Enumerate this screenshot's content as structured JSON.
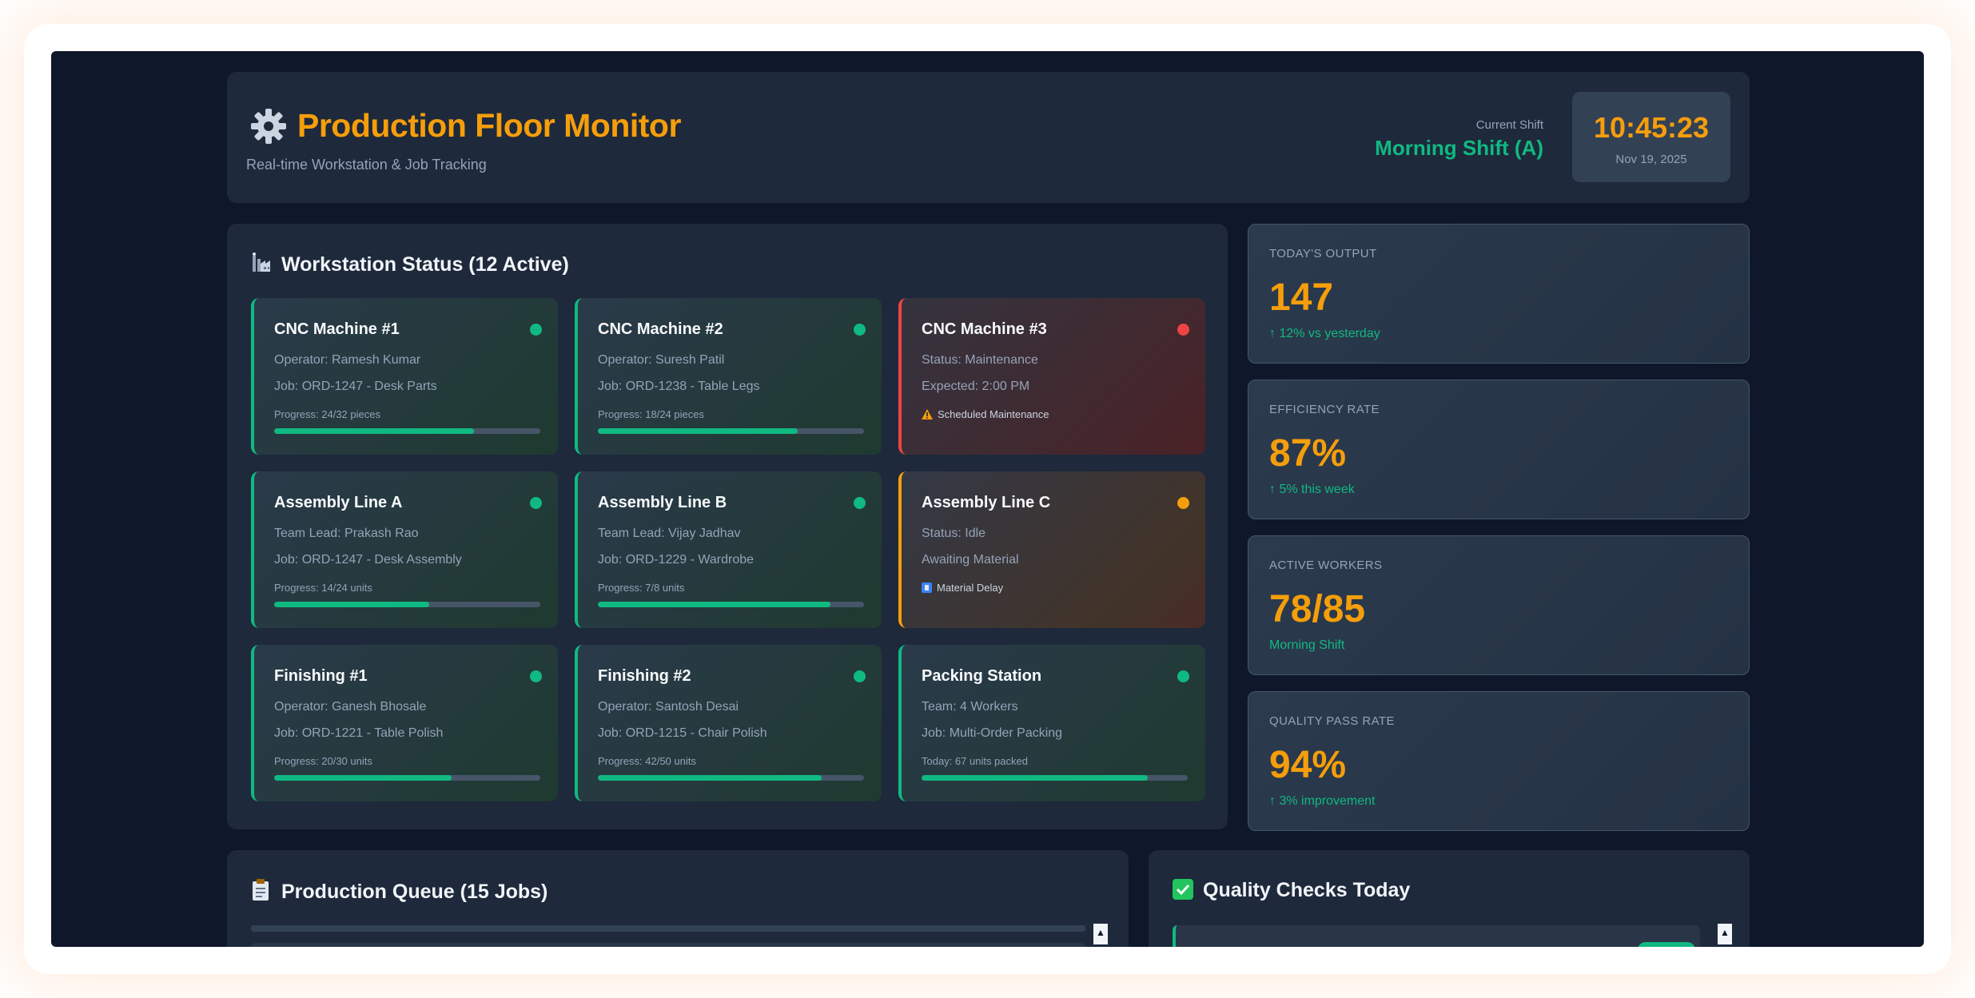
{
  "header": {
    "title": "Production Floor Monitor",
    "subtitle": "Real-time Workstation & Job Tracking",
    "icon": "gear-icon",
    "shift_label": "Current Shift",
    "shift_name": "Morning Shift (A)",
    "clock_time": "10:45:23",
    "clock_date": "Nov 19, 2025"
  },
  "workstations": {
    "title": "Workstation Status (12 Active)",
    "icon": "factory-icon",
    "cards": [
      {
        "name": "CNC Machine #1",
        "line1": "Operator: Ramesh Kumar",
        "line2": "Job: ORD-1247 - Desk Parts",
        "progress_label": "Progress: 24/32 pieces",
        "progress": 0.75,
        "status": "active"
      },
      {
        "name": "CNC Machine #2",
        "line1": "Operator: Suresh Patil",
        "line2": "Job: ORD-1238 - Table Legs",
        "progress_label": "Progress: 18/24 pieces",
        "progress": 0.75,
        "status": "active"
      },
      {
        "name": "CNC Machine #3",
        "line1": "Status: Maintenance",
        "line2": "Expected: 2:00 PM",
        "note": "Scheduled Maintenance",
        "note_icon": "warning-icon",
        "status": "down"
      },
      {
        "name": "Assembly Line A",
        "line1": "Team Lead: Prakash Rao",
        "line2": "Job: ORD-1247 - Desk Assembly",
        "progress_label": "Progress: 14/24 units",
        "progress": 0.583,
        "status": "active"
      },
      {
        "name": "Assembly Line B",
        "line1": "Team Lead: Vijay Jadhav",
        "line2": "Job: ORD-1229 - Wardrobe",
        "progress_label": "Progress: 7/8 units",
        "progress": 0.875,
        "status": "active"
      },
      {
        "name": "Assembly Line C",
        "line1": "Status: Idle",
        "line2": "Awaiting Material",
        "note": "Material Delay",
        "note_icon": "box-icon",
        "status": "idle"
      },
      {
        "name": "Finishing #1",
        "line1": "Operator: Ganesh Bhosale",
        "line2": "Job: ORD-1221 - Table Polish",
        "progress_label": "Progress: 20/30 units",
        "progress": 0.667,
        "status": "active"
      },
      {
        "name": "Finishing #2",
        "line1": "Operator: Santosh Desai",
        "line2": "Job: ORD-1215 - Chair Polish",
        "progress_label": "Progress: 42/50 units",
        "progress": 0.84,
        "status": "active"
      },
      {
        "name": "Packing Station",
        "line1": "Team: 4 Workers",
        "line2": "Job: Multi-Order Packing",
        "progress_label": "Today: 67 units packed",
        "progress": 0.85,
        "status": "active"
      }
    ]
  },
  "stats": [
    {
      "label": "TODAY'S OUTPUT",
      "value": "147",
      "sub": "↑ 12% vs yesterday"
    },
    {
      "label": "EFFICIENCY RATE",
      "value": "87%",
      "sub": "↑ 5% this week"
    },
    {
      "label": "ACTIVE WORKERS",
      "value": "78/85",
      "sub": "Morning Shift"
    },
    {
      "label": "QUALITY PASS RATE",
      "value": "94%",
      "sub": "↑ 3% improvement"
    }
  ],
  "queue": {
    "title": "Production Queue (15 Jobs)",
    "icon": "clipboard-icon"
  },
  "quality": {
    "title": "Quality Checks Today",
    "icon": "checkbox-icon"
  },
  "colors": {
    "accent": "#f59e0b",
    "success": "#10b981",
    "danger": "#ef4444",
    "bg": "#0f172a",
    "panel": "#1e293b"
  }
}
